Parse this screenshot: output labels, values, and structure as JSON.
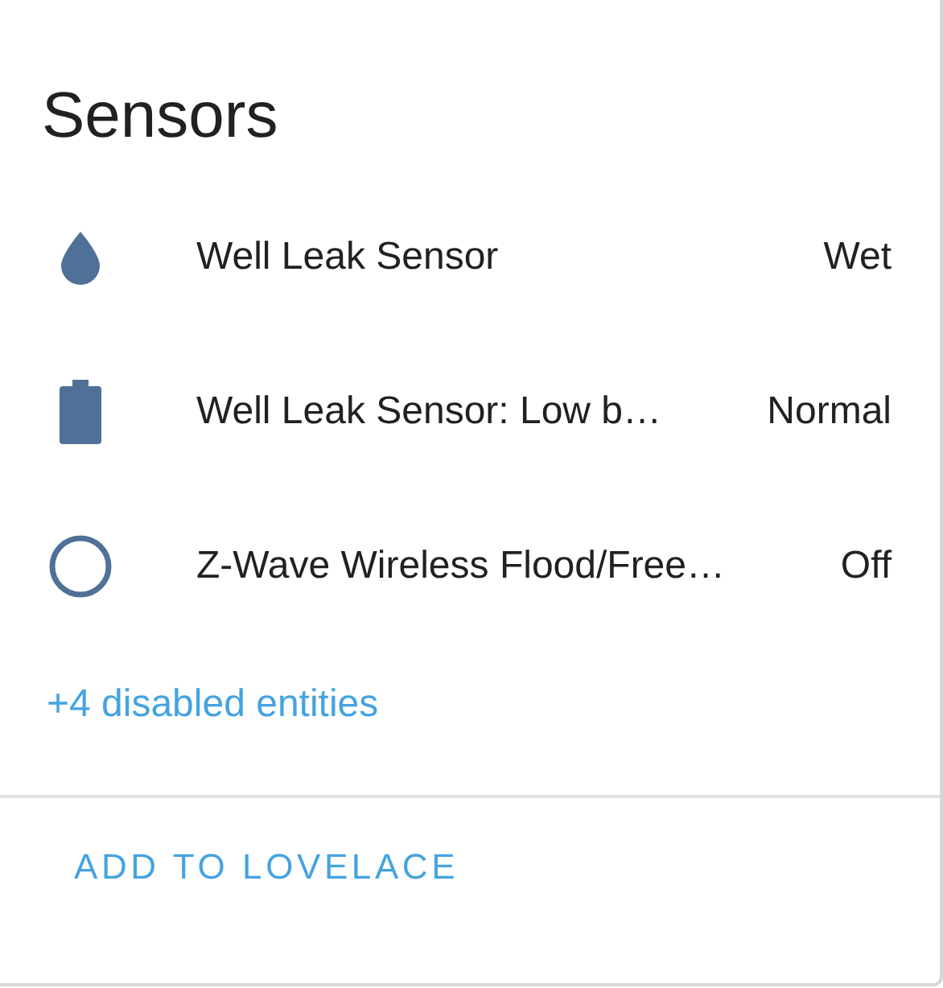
{
  "card": {
    "title": "Sensors",
    "entities": [
      {
        "kind": "drop",
        "name": "Well Leak Sensor",
        "state": "Wet"
      },
      {
        "kind": "battery",
        "name": "Well Leak Sensor: Low b…",
        "state": "Normal"
      },
      {
        "kind": "ring",
        "name": "Z-Wave Wireless Flood/Free…",
        "state": "Off"
      }
    ],
    "disabled_link": "+4 disabled entities",
    "action_button": "ADD TO LOVELACE"
  }
}
